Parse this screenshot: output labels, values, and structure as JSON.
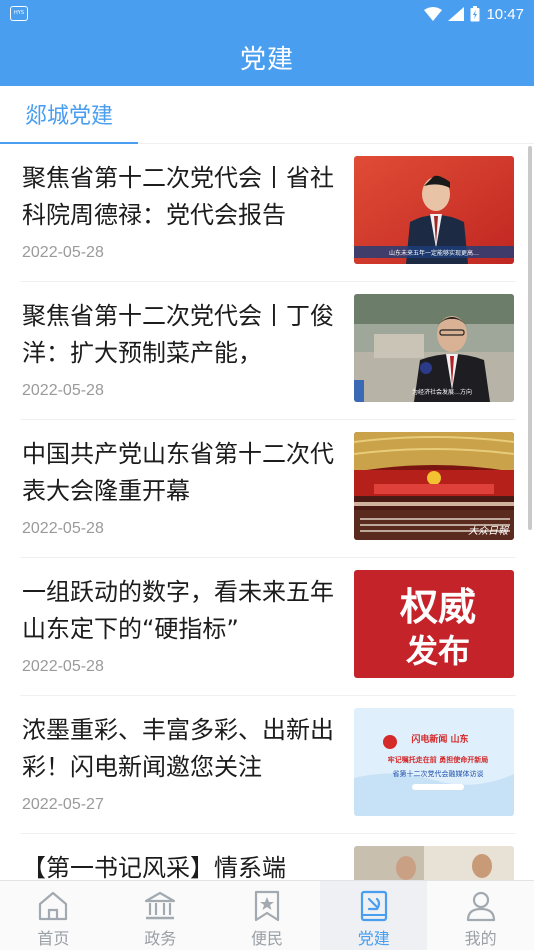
{
  "status": {
    "time": "10:47",
    "app_icon_text": "HYS"
  },
  "header": {
    "title": "党建"
  },
  "section_tab": {
    "label": "郯城党建"
  },
  "articles": [
    {
      "title": "聚焦省第十二次党代会丨省社科院周德禄：党代会报告",
      "date": "2022-05-28",
      "thumb_caption": "山东未来五年一定能够实现更高…"
    },
    {
      "title": "聚焦省第十二次党代会丨丁俊洋：扩大预制菜产能，",
      "date": "2022-05-28",
      "thumb_caption": "为经济社会发展…方向"
    },
    {
      "title": "中国共产党山东省第十二次代表大会隆重开幕",
      "date": "2022-05-28",
      "thumb_caption": ""
    },
    {
      "title": "一组跃动的数字，看未来五年山东定下的“硬指标”",
      "date": "2022-05-28",
      "thumb_line1": "权威",
      "thumb_line2": "发布"
    },
    {
      "title": "浓墨重彩、丰富多彩、出新出彩！闪电新闻邀您关注",
      "date": "2022-05-27",
      "thumb_line1": "牢记嘱托走在前 勇担使命开新局",
      "thumb_line2": "省第十二次党代会融媒体访谈"
    },
    {
      "title": "【第一书记风采】情系端",
      "date": "",
      "thumb_caption": ""
    }
  ],
  "tabbar": [
    {
      "label": "首页",
      "icon": "home-icon"
    },
    {
      "label": "政务",
      "icon": "government-building-icon"
    },
    {
      "label": "便民",
      "icon": "bookmark-star-icon"
    },
    {
      "label": "党建",
      "icon": "party-book-icon",
      "active": true
    },
    {
      "label": "我的",
      "icon": "person-icon"
    }
  ],
  "colors": {
    "primary": "#4a9ef0",
    "party_red": "#c8202a"
  }
}
